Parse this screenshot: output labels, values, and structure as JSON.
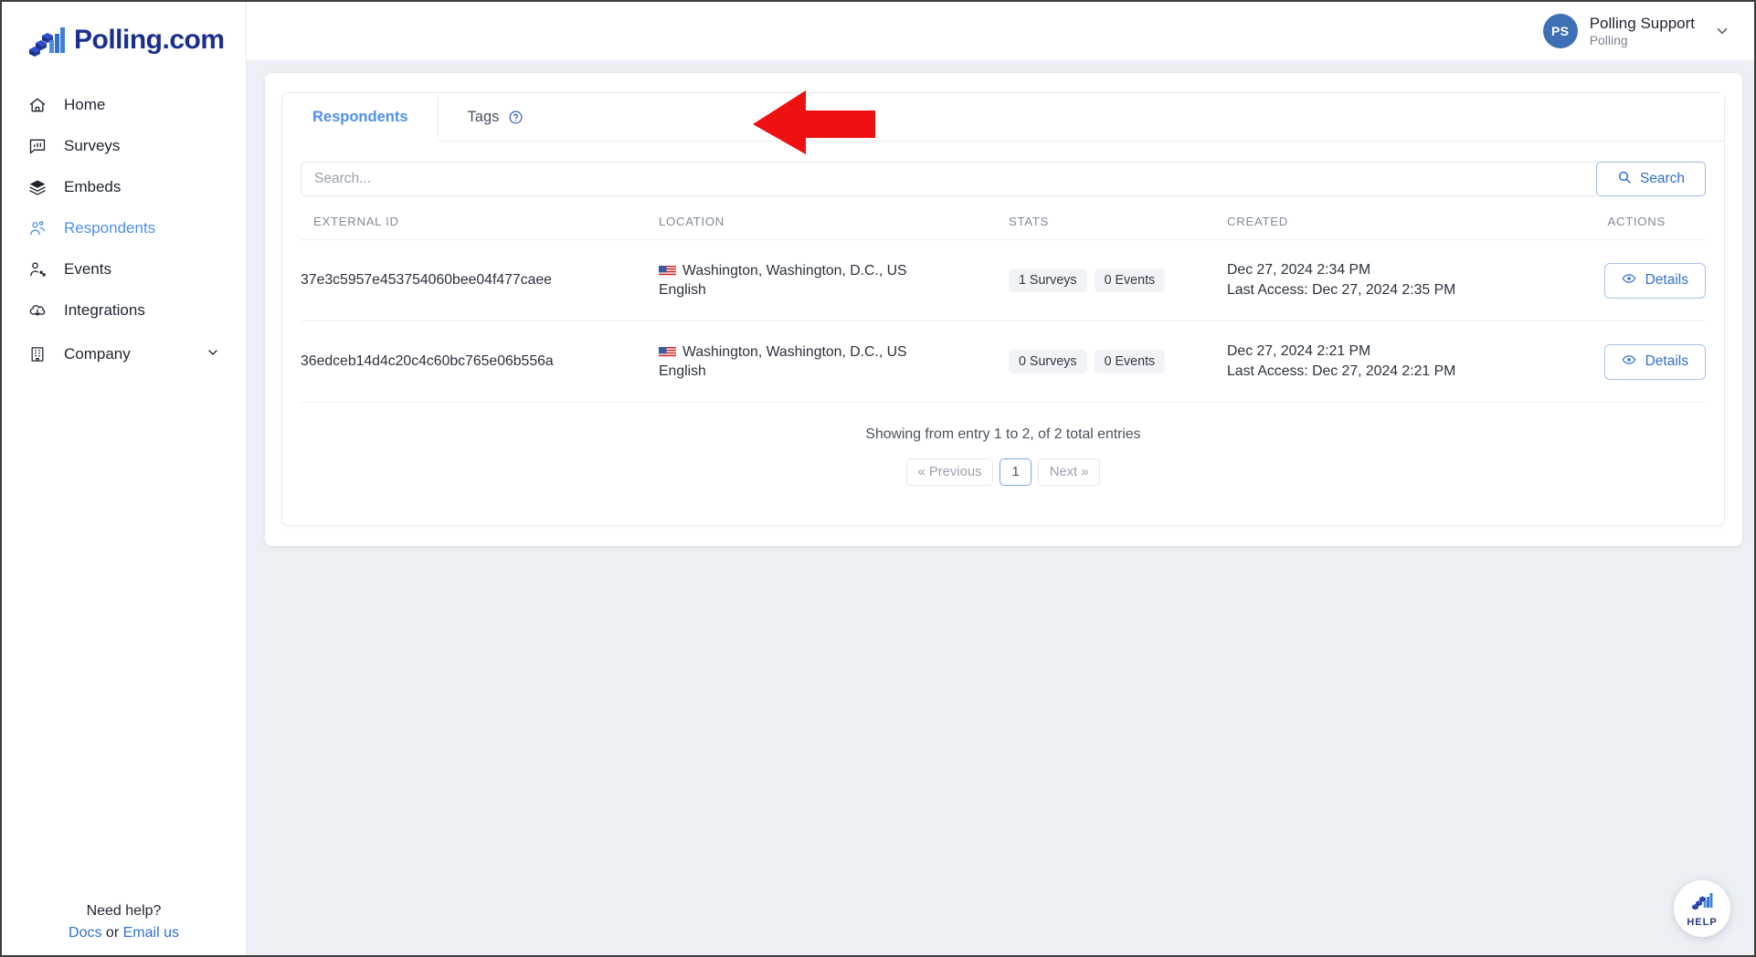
{
  "brand": {
    "name": "Polling.com",
    "logo_icon": "bar-chart-3d-logo"
  },
  "sidebar": {
    "items": [
      {
        "label": "Home",
        "icon": "home-icon",
        "active": false
      },
      {
        "label": "Surveys",
        "icon": "survey-chart-icon",
        "active": false
      },
      {
        "label": "Embeds",
        "icon": "layers-icon",
        "active": false
      },
      {
        "label": "Respondents",
        "icon": "users-icon",
        "active": true
      },
      {
        "label": "Events",
        "icon": "user-activity-icon",
        "active": false
      },
      {
        "label": "Integrations",
        "icon": "plug-cloud-icon",
        "active": false
      },
      {
        "label": "Company",
        "icon": "building-icon",
        "active": false,
        "chevron": "chevron-down-icon"
      }
    ],
    "footer": {
      "need_help": "Need help?",
      "docs": "Docs",
      "or": " or ",
      "email_us": "Email us"
    }
  },
  "topbar": {
    "avatar_initials": "PS",
    "user_name": "Polling Support",
    "user_org": "Polling",
    "chevron_icon": "chevron-down-icon"
  },
  "tabs": [
    {
      "label": "Respondents",
      "active": true
    },
    {
      "label": "Tags",
      "active": false
    }
  ],
  "tab_help_icon": "question-circle-icon",
  "search": {
    "placeholder": "Search...",
    "value": "",
    "button_label": "Search",
    "button_icon": "search-icon"
  },
  "table": {
    "columns": [
      "EXTERNAL ID",
      "LOCATION",
      "STATS",
      "CREATED",
      "ACTIONS"
    ],
    "rows": [
      {
        "external_id": "37e3c5957e453754060bee04f477caee",
        "location": "Washington, Washington, D.C., US",
        "language": "English",
        "flag": "us-flag-icon",
        "surveys": "1 Surveys",
        "events": "0 Events",
        "created": "Dec 27, 2024 2:34 PM",
        "last_access": "Last Access: Dec 27, 2024 2:35 PM",
        "action_label": "Details",
        "action_icon": "eye-icon"
      },
      {
        "external_id": "36edceb14d4c20c4c60bc765e06b556a",
        "location": "Washington, Washington, D.C., US",
        "language": "English",
        "flag": "us-flag-icon",
        "surveys": "0 Surveys",
        "events": "0 Events",
        "created": "Dec 27, 2024 2:21 PM",
        "last_access": "Last Access: Dec 27, 2024 2:21 PM",
        "action_label": "Details",
        "action_icon": "eye-icon"
      }
    ]
  },
  "pagination": {
    "showing": "Showing from entry 1 to 2, of 2 total entries",
    "previous": "« Previous",
    "current_page": "1",
    "next": "Next »"
  },
  "help_fab": {
    "label": "HELP",
    "icon": "bar-chart-3d-logo"
  },
  "annotation": {
    "arrow_icon": "left-arrow-annotation",
    "color": "#ee1111"
  },
  "colors": {
    "brand_navy": "#1b2f8f",
    "accent_blue": "#4f8ff0",
    "link_blue": "#2f6fd0",
    "page_bg": "#eceff4",
    "text": "#2b313c",
    "muted": "#828a97",
    "annotation_red": "#ee1111"
  }
}
